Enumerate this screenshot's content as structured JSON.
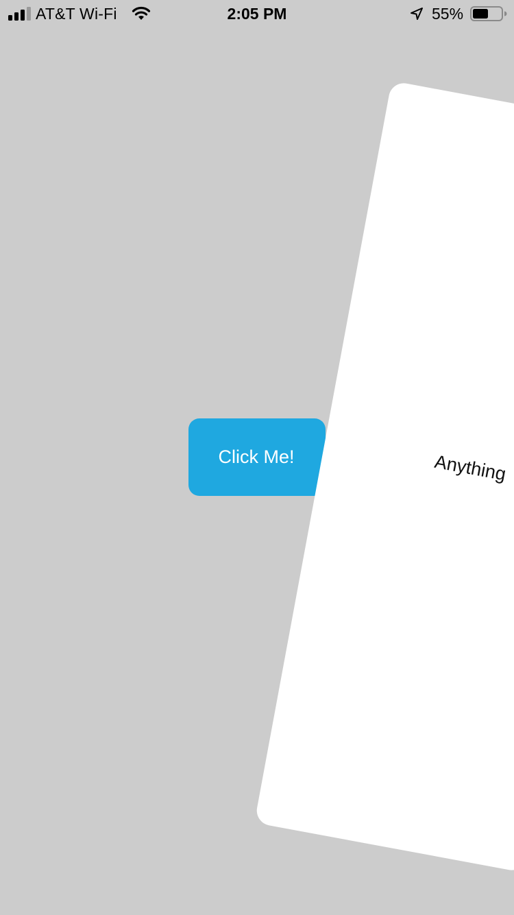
{
  "status_bar": {
    "carrier": "AT&T Wi-Fi",
    "time": "2:05 PM",
    "battery_percent": "55%",
    "battery_level": 0.55,
    "icons": [
      "signal-bars-icon",
      "wifi-icon",
      "location-arrow-icon",
      "battery-icon"
    ]
  },
  "main": {
    "button_label": "Click Me!",
    "card_text": "Anything"
  },
  "colors": {
    "background": "#cccccc",
    "button": "#1fa8e0",
    "button_text": "#ffffff",
    "card": "#ffffff",
    "card_text": "#111111"
  }
}
